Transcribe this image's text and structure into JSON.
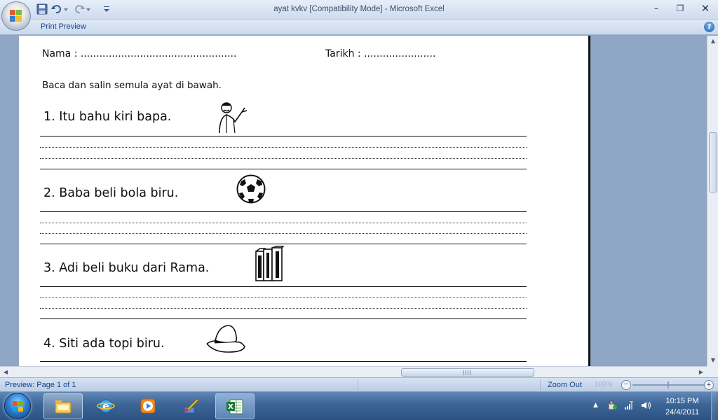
{
  "window": {
    "title": "ayat kvkv  [Compatibility Mode] - Microsoft Excel",
    "minimize": "–",
    "maximize": "❐",
    "close": "✕"
  },
  "quick_access": {
    "save_icon": "save-icon",
    "undo_icon": "undo-icon",
    "redo_icon": "redo-icon",
    "customize_icon": "chevron-down-icon"
  },
  "ribbon": {
    "active_tab": "Print Preview",
    "help": "?"
  },
  "worksheet": {
    "nama": "Nama   :  ..................................................",
    "tarikh": "Tarikh : .......................",
    "instruction": "Baca dan salin semula ayat di bawah.",
    "sentences": [
      {
        "text": "1. Itu bahu kiri bapa.",
        "picture": "man-pointing-shoulder"
      },
      {
        "text": "2.  Baba beli bola biru.",
        "picture": "soccer-ball"
      },
      {
        "text": "3. Adi beli buku dari Rama.",
        "picture": "books"
      },
      {
        "text": "4. Siti ada topi biru.",
        "picture": "hat"
      }
    ]
  },
  "statusbar": {
    "preview_text": "Preview: Page 1 of 1",
    "zoom_out": "Zoom Out",
    "zoom_level": "100%",
    "zoom_minus": "−",
    "zoom_plus": "+"
  },
  "taskbar": {
    "time": "10:15 PM",
    "date": "24/4/2011",
    "buttons": [
      "windows-explorer",
      "internet-explorer",
      "media-player",
      "paint-tool",
      "excel"
    ],
    "active_button": "excel"
  },
  "colors": {
    "ribbon_text": "#15428b",
    "preview_background": "#8fa6c4",
    "taskbar": "#3c6596"
  }
}
